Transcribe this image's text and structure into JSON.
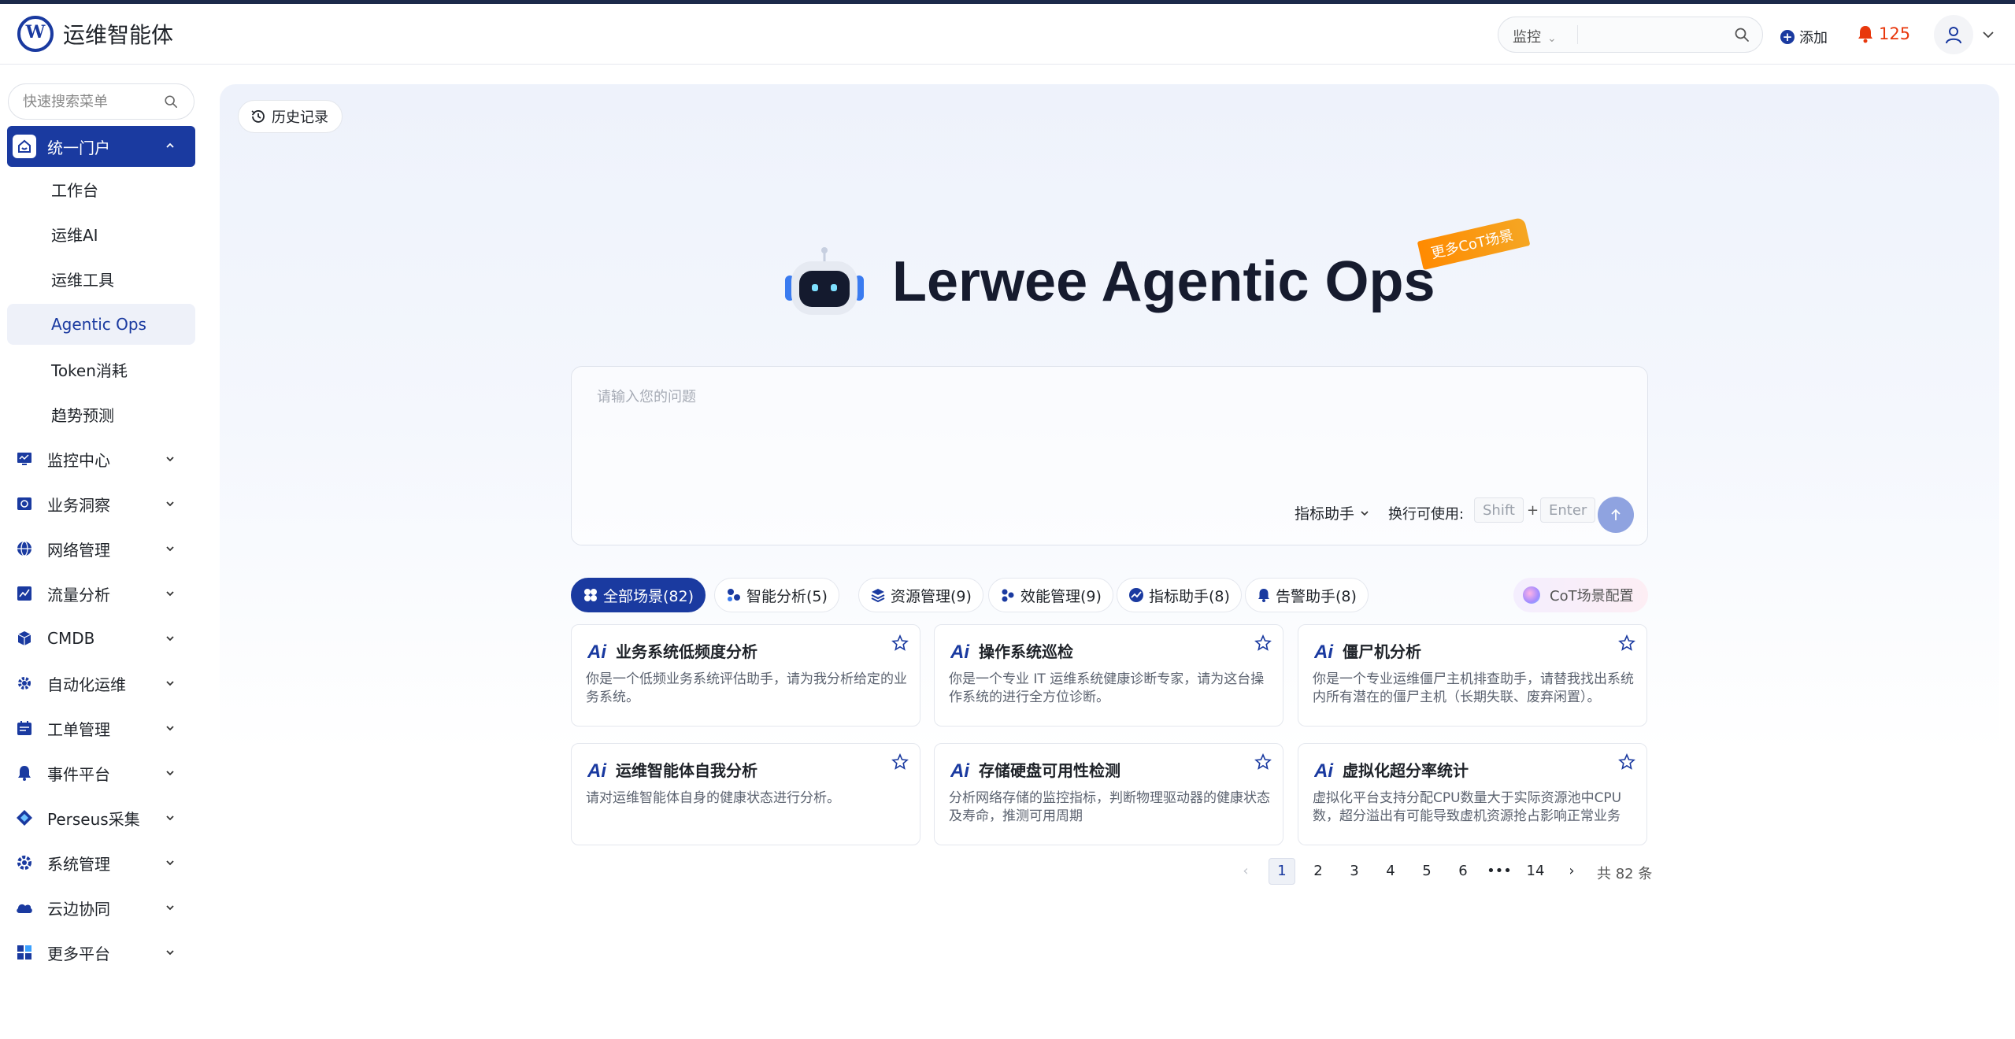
{
  "app": {
    "title": "运维智能体",
    "logo_letter": "W"
  },
  "header": {
    "search_type": "监控",
    "search_placeholder": "",
    "add_label": "添加",
    "alert_count": "125",
    "colors": {
      "brand": "#1a3aa0",
      "alert": "#e8380d"
    }
  },
  "sidebar": {
    "search_placeholder": "快速搜索菜单",
    "active_group": {
      "label": "统一门户",
      "icon": "portal-icon"
    },
    "sub_items": [
      {
        "label": "工作台"
      },
      {
        "label": "运维AI"
      },
      {
        "label": "运维工具"
      },
      {
        "label": "Agentic Ops",
        "selected": true
      },
      {
        "label": "Token消耗"
      },
      {
        "label": "趋势预测"
      }
    ],
    "groups": [
      {
        "label": "监控中心",
        "icon": "monitor-icon"
      },
      {
        "label": "业务洞察",
        "icon": "insight-icon"
      },
      {
        "label": "网络管理",
        "icon": "globe-icon"
      },
      {
        "label": "流量分析",
        "icon": "chart-icon"
      },
      {
        "label": "CMDB",
        "icon": "cube-icon"
      },
      {
        "label": "自动化运维",
        "icon": "gear-auto-icon"
      },
      {
        "label": "工单管理",
        "icon": "calendar-icon"
      },
      {
        "label": "事件平台",
        "icon": "bell-icon"
      },
      {
        "label": "Perseus采集",
        "icon": "diamond-icon"
      },
      {
        "label": "系统管理",
        "icon": "settings-icon"
      },
      {
        "label": "云边协同",
        "icon": "cloud-icon"
      },
      {
        "label": "更多平台",
        "icon": "grid-icon"
      }
    ]
  },
  "main": {
    "history_label": "历史记录",
    "hero_title": "Lerwee Agentic Ops",
    "hero_badge": "更多CoT场景",
    "ask": {
      "placeholder": "请输入您的问题",
      "assistant": "指标助手",
      "newline_hint": "换行可使用:",
      "key1": "Shift",
      "plus": "+",
      "key2": "Enter"
    },
    "tabs": [
      {
        "label": "全部场景(82)",
        "icon": "all-scenes-icon",
        "active": true
      },
      {
        "label": "智能分析(5)",
        "icon": "smart-analysis-icon"
      },
      {
        "label": "资源管理(9)",
        "icon": "layers-icon"
      },
      {
        "label": "效能管理(9)",
        "icon": "efficiency-icon"
      },
      {
        "label": "指标助手(8)",
        "icon": "trend-icon"
      },
      {
        "label": "告警助手(8)",
        "icon": "bell-icon"
      }
    ],
    "cot_config": "CoT场景配置",
    "cards": [
      {
        "title": "业务系统低频度分析",
        "desc": "你是一个低频业务系统评估助手，请为我分析给定的业务系统。"
      },
      {
        "title": "操作系统巡检",
        "desc": "你是一个专业 IT 运维系统健康诊断专家，请为这台操作系统的进行全方位诊断。"
      },
      {
        "title": "僵尸机分析",
        "desc": "你是一个专业运维僵尸主机排查助手，请替我找出系统内所有潜在的僵尸主机（长期失联、废弃闲置）。"
      },
      {
        "title": "运维智能体自我分析",
        "desc": "请对运维智能体自身的健康状态进行分析。"
      },
      {
        "title": "存储硬盘可用性检测",
        "desc": "分析网络存储的监控指标，判断物理驱动器的健康状态及寿命，推测可用周期"
      },
      {
        "title": "虚拟化超分率统计",
        "desc": "虚拟化平台支持分配CPU数量大于实际资源池中CPU数，超分溢出有可能导致虚机资源抢占影响正常业务"
      }
    ],
    "pagination": {
      "prev": "‹",
      "pages": [
        "1",
        "2",
        "3",
        "4",
        "5",
        "6",
        "•••",
        "14"
      ],
      "current": "1",
      "next": "›",
      "total": "共 82 条"
    }
  }
}
